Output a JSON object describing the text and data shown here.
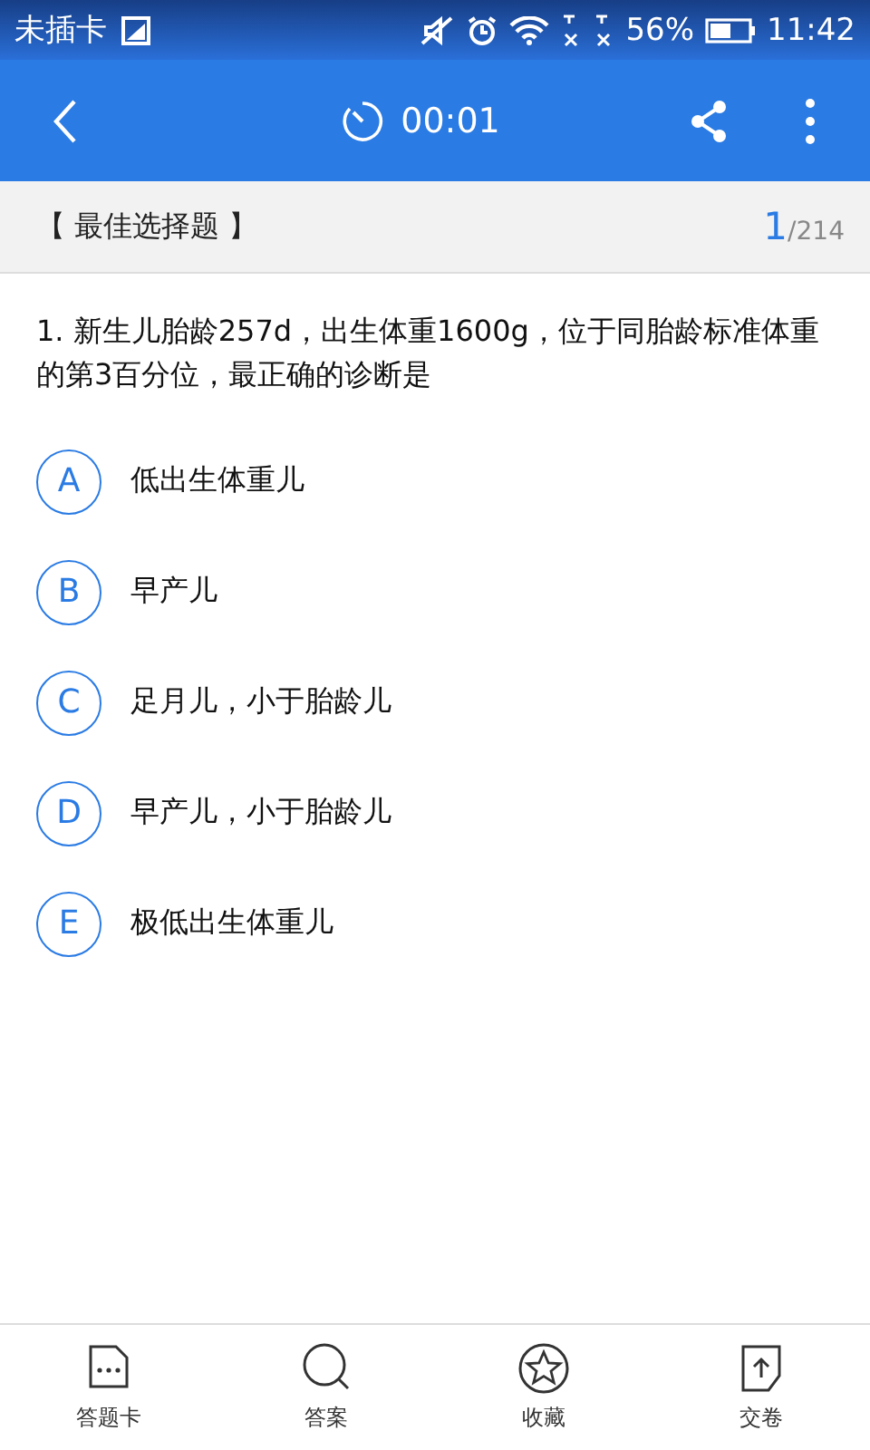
{
  "status_bar": {
    "carrier": "未插卡",
    "battery": "56%",
    "time": "11:42"
  },
  "app_bar": {
    "timer": "00:01"
  },
  "section": {
    "title": "【 最佳选择题 】",
    "current": "1",
    "total": "/214"
  },
  "question": {
    "text": "1. 新生儿胎龄257d，出生体重1600g，位于同胎龄标准体重的第3百分位，最正确的诊断是"
  },
  "options": [
    {
      "letter": "A",
      "text": "低出生体重儿",
      "selected": false
    },
    {
      "letter": "B",
      "text": "早产儿",
      "selected": false
    },
    {
      "letter": "C",
      "text": "足月儿，小于胎龄儿",
      "selected": false
    },
    {
      "letter": "D",
      "text": "早产儿，小于胎龄儿",
      "selected": false
    },
    {
      "letter": "E",
      "text": "极低出生体重儿",
      "selected": false
    }
  ],
  "bottom_nav": [
    {
      "kind": "card",
      "label": "答题卡"
    },
    {
      "kind": "answer",
      "label": "答案"
    },
    {
      "kind": "favorite",
      "label": "收藏"
    },
    {
      "kind": "submit",
      "label": "交卷"
    }
  ]
}
